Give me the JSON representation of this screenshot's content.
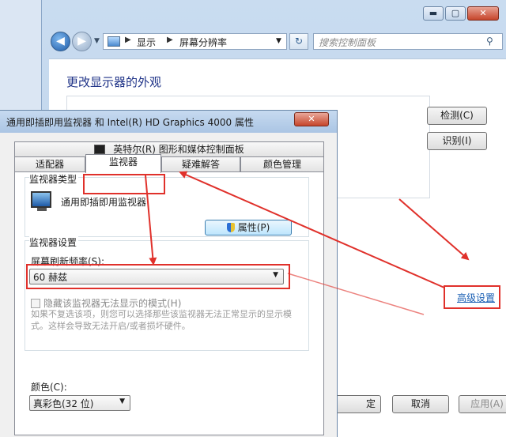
{
  "background_window": {
    "address": {
      "segment1": "显示",
      "segment2": "屏幕分辨率"
    },
    "search_placeholder": "搜索控制面板",
    "title": "更改显示器的外观",
    "detect_label": "检测(C)",
    "identify_label": "识别(I)",
    "advanced_link": "高级设置",
    "ok_partial": "定",
    "cancel_label": "取消",
    "apply_label": "应用(A)",
    "window_buttons": {
      "minimize": "▬",
      "maximize": "▢",
      "close": "✕"
    }
  },
  "dialog": {
    "title": "通用即插即用监视器 和 Intel(R) HD Graphics 4000 属性",
    "close": "✕",
    "tabs": {
      "intel": "英特尔(R) 图形和媒体控制面板",
      "adapter": "适配器",
      "monitor": "监视器",
      "troubleshoot": "疑难解答",
      "color_mgmt": "颜色管理"
    },
    "monitor_type": {
      "label": "监视器类型",
      "name": "通用即插即用监视器",
      "properties_button": "属性(P)"
    },
    "monitor_settings": {
      "label": "监视器设置",
      "refresh_label": "屏幕刷新频率(S):",
      "refresh_value": "60 赫兹",
      "hide_modes_label": "隐藏该监视器无法显示的模式(H)",
      "hide_modes_desc": "如果不复选该项，则您可以选择那些该监视器无法正常显示的显示模式。这样会导致无法开启/或者损坏硬件。"
    },
    "colors": {
      "label": "颜色(C):",
      "value": "真彩色(32 位)"
    }
  },
  "colors": {
    "annotation_red": "#e0312b",
    "link_blue": "#1a5fb4"
  }
}
